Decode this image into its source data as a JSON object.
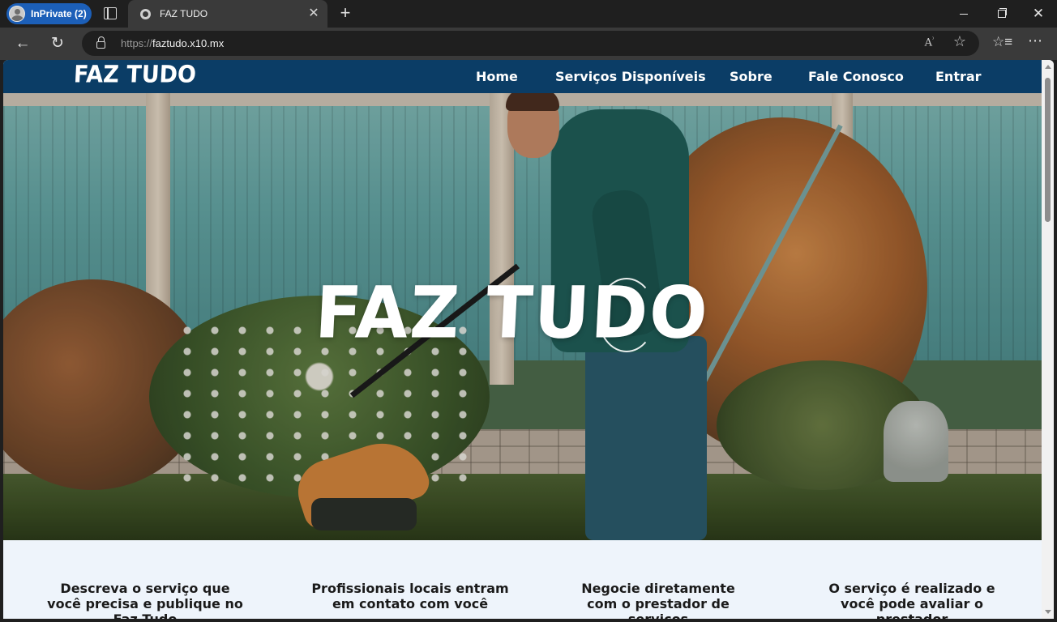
{
  "browser": {
    "profile_label": "InPrivate (2)",
    "tab_title": "FAZ TUDO",
    "url_scheme": "https://",
    "url_host": "faztudo.x10.mx",
    "icons": [
      "profile-avatar-icon",
      "tab-actions-icon",
      "site-favicon",
      "close-icon",
      "plus-icon",
      "back-arrow-icon",
      "reload-icon",
      "lock-icon",
      "read-aloud-icon",
      "star-icon",
      "favorites-icon",
      "more-icon",
      "minimize-icon",
      "maximize-icon",
      "window-close-icon"
    ]
  },
  "site": {
    "logo": "FAZ TUDO",
    "nav": {
      "home": "Home",
      "servicos": "Serviços Disponíveis",
      "sobre": "Sobre",
      "fale": "Fale Conosco",
      "entrar": "Entrar"
    },
    "header_color": "#0b3d66",
    "hero_title": "FAZ TUDO",
    "steps": [
      "Descreva o serviço que você precisa e publique no Faz Tudo",
      "Profissionais locais entram em contato com você",
      "Negocie diretamente com o prestador de serviços",
      "O serviço é realizado e você pode avaliar o prestador"
    ]
  }
}
